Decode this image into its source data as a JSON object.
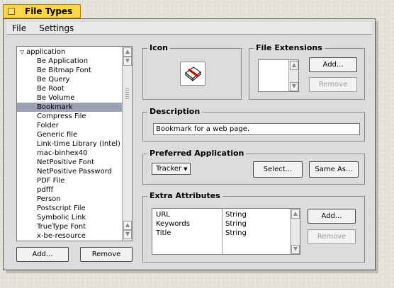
{
  "window": {
    "title": "File Types"
  },
  "menu": {
    "items": [
      "File",
      "Settings"
    ]
  },
  "types_list": {
    "expander": "▽",
    "root": "application",
    "items": [
      "Be Application",
      "Be Bitmap Font",
      "Be Query",
      "Be Root",
      "Be Volume",
      "Bookmark",
      "Compress File",
      "Folder",
      "Generic file",
      "Link-time Library (Intel)",
      "mac-binhex40",
      "NetPositive Font",
      "NetPositive Password",
      "PDF File",
      "pdfff",
      "Person",
      "Postscript File",
      "Symbolic Link",
      "TrueType Font",
      "x-be-resource"
    ],
    "selected_index": 5
  },
  "left_buttons": {
    "add": "Add...",
    "remove": "Remove"
  },
  "icon_group": {
    "title": "Icon",
    "icon_name": "bookmark-icon"
  },
  "file_extensions": {
    "title": "File Extensions",
    "add": "Add...",
    "remove": "Remove"
  },
  "description": {
    "title": "Description",
    "value": "Bookmark for a web page."
  },
  "preferred_app": {
    "title": "Preferred Application",
    "selected": "Tracker",
    "select": "Select...",
    "same_as": "Same As..."
  },
  "extra_attributes": {
    "title": "Extra Attributes",
    "rows": [
      {
        "name": "URL",
        "type": "String"
      },
      {
        "name": "Keywords",
        "type": "String"
      },
      {
        "name": "Title",
        "type": "String"
      }
    ],
    "add": "Add...",
    "remove": "Remove"
  },
  "colors": {
    "tab": "#ffd54a",
    "selection": "#9aa2b3",
    "window": "#dcdcdc"
  }
}
